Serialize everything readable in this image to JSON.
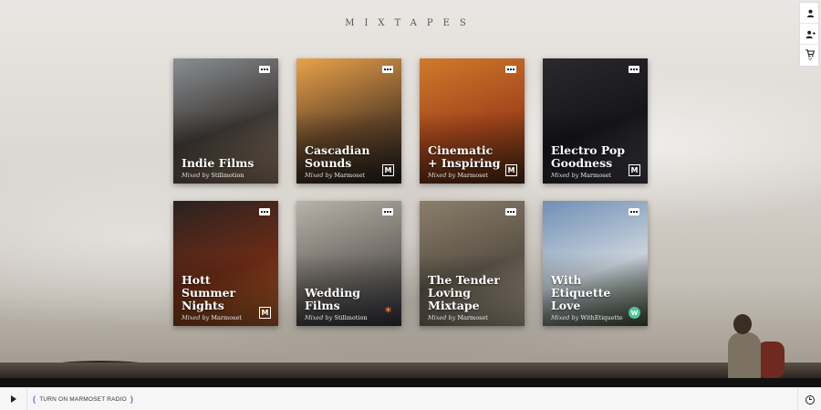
{
  "header": {
    "title": "MIXTAPES"
  },
  "toolbar": {
    "items": [
      {
        "icon": "user-icon"
      },
      {
        "icon": "add-user-icon"
      },
      {
        "icon": "cart-icon",
        "count": "0"
      }
    ]
  },
  "mixtapes": [
    {
      "name": "Indie Films",
      "mixed_by_label": "Mixed by",
      "curator": "Stillmotion",
      "badge": "",
      "colors": [
        "#8a8f94",
        "#3f3a36",
        "#a78b70"
      ]
    },
    {
      "name": "Cascadian Sounds",
      "mixed_by_label": "Mixed by",
      "curator": "Marmoset",
      "badge": "M",
      "colors": [
        "#e9a24a",
        "#6b4a2a",
        "#2a2520"
      ]
    },
    {
      "name": "Cinematic + Inspiring",
      "mixed_by_label": "Mixed by",
      "curator": "Marmoset",
      "badge": "M",
      "colors": [
        "#d07a2a",
        "#a4461c",
        "#5a2f15"
      ]
    },
    {
      "name": "Electro Pop Goodness",
      "mixed_by_label": "Mixed by",
      "curator": "Marmoset",
      "badge": "M",
      "colors": [
        "#2a2a2e",
        "#15151a",
        "#4a4a55"
      ]
    },
    {
      "name": "Hott Summer Nights",
      "mixed_by_label": "Mixed by",
      "curator": "Marmoset",
      "badge": "M",
      "colors": [
        "#2a2220",
        "#6b2b16",
        "#c46a2a"
      ]
    },
    {
      "name": "Wedding Films",
      "mixed_by_label": "Mixed by",
      "curator": "Stillmotion",
      "badge": "*",
      "colors": [
        "#b8b2aa",
        "#6f6a64",
        "#3a3a45"
      ]
    },
    {
      "name": "The Tender Loving Mixtape",
      "mixed_by_label": "Mixed by",
      "curator": "Marmoset",
      "badge": "",
      "colors": [
        "#8b7e6a",
        "#5a5246",
        "#c5b8a0"
      ]
    },
    {
      "name": "With Etiquette Love",
      "mixed_by_label": "Mixed by",
      "curator": "WithEtiquette",
      "badge": "W",
      "colors": [
        "#6f8fb5",
        "#c9d2dc",
        "#4a5a40"
      ]
    }
  ],
  "footer": {
    "radio_label": "TURN ON MARMOSET RADIO"
  }
}
